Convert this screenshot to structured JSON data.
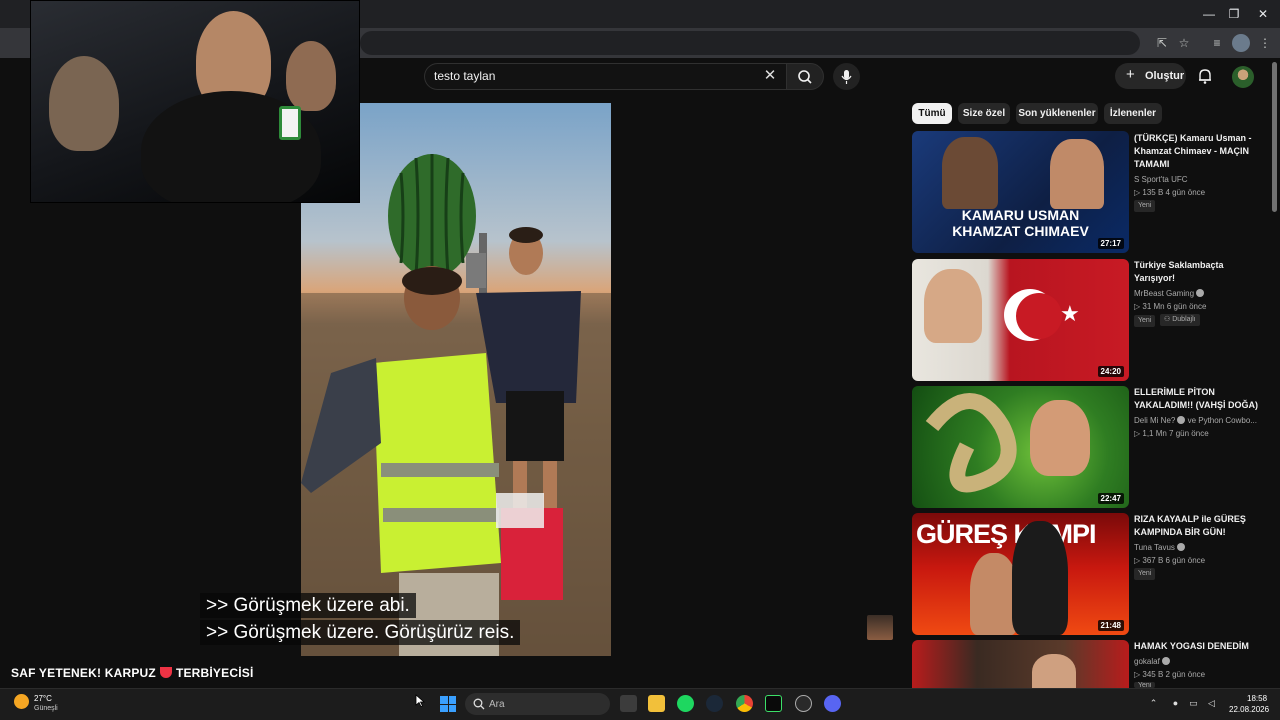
{
  "browser": {
    "window_controls": [
      "—",
      "❐",
      "✕"
    ]
  },
  "search": {
    "query": "testo taylan"
  },
  "header": {
    "create_label": "Oluştur"
  },
  "player": {
    "subtitles": [
      ">> Görüşmek üzere abi.",
      ">> Görüşmek üzere. Görüşürüz reis."
    ]
  },
  "chips": [
    "Tümü",
    "Size özel",
    "Son yüklenenler",
    "İzlenenler"
  ],
  "recommendations": [
    {
      "title": "(TÜRKÇE) Kamaru Usman - Khamzat Chimaev - MAÇIN TAMAMI",
      "channel": "S Sport'ta UFC",
      "meta": "▷ 135 B   4 gün önce",
      "badge": "Yeni",
      "duration": "27:17",
      "thumb_text": "KAMARU USMAN\nKHAMZAT CHIMAEV"
    },
    {
      "title": "Türkiye Saklambaçta Yarışıyor!",
      "channel": "MrBeast Gaming",
      "meta": "▷ 31 Mn   6 gün önce",
      "badge": "Yeni",
      "badge2": "Dublajlı",
      "duration": "24:20"
    },
    {
      "title": "ELLERİMLE PİTON YAKALADIM!! (VAHŞİ DOĞA)",
      "channel": "Deli Mi Ne?",
      "channel_extra": "ve Python Cowbo...",
      "meta": "▷ 1,1 Mn   7 gün önce",
      "duration": "22:47"
    },
    {
      "title": "RIZA KAYAALP ile GÜREŞ KAMPINDA BİR GÜN!",
      "channel": "Tuna Tavus",
      "meta": "▷ 367 B   6 gün önce",
      "badge": "Yeni",
      "duration": "21:48",
      "thumb_text": "GÜREŞ KAMPI"
    },
    {
      "title": "HAMAK YOGASI DENEDİM",
      "channel": "gokalaf",
      "meta": "▷ 345 B   2 gün önce",
      "badge": "Yeni"
    }
  ],
  "stream": {
    "caption_left": "SAF YETENEK! KARPUZ",
    "caption_right": "TERBİYECİSİ"
  },
  "taskbar": {
    "weather_temp": "27°C",
    "weather_desc": "Güneşli",
    "search_label": "Ara",
    "time": "18:58",
    "date": "22.08.2026"
  },
  "colors": {
    "background": "#0f0f0f",
    "chip_active": "#f1f1f1",
    "chip": "#272727",
    "taskbar": "#1c1c1c"
  }
}
